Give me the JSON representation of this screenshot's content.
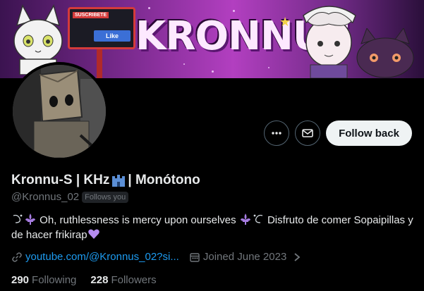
{
  "banner": {
    "title": "KRONNUS",
    "sign_label": "SUSCRIBETE",
    "like_label": "Like"
  },
  "profile": {
    "display_name_part1": "Kronnu-S | KHz",
    "display_name_part2": "| Monótono",
    "handle": "@Kronnus_02",
    "follows_you_badge": "Follows you",
    "bio_part1": "Oh, ruthlessness is mercy upon ourselves",
    "bio_part2": "Disfruto de comer Sopaipillas y de hacer frikirap",
    "link_text": "youtube.com/@Kronnus_02?si...",
    "joined_text": "Joined June 2023",
    "following_count": "290",
    "following_label": "Following",
    "followers_count": "228",
    "followers_label": "Followers"
  },
  "actions": {
    "more_icon": "more-horizontal-icon",
    "message_icon": "envelope-icon",
    "follow_back_label": "Follow back"
  },
  "colors": {
    "background": "#000000",
    "accent_link": "#1d9bf0",
    "muted_text": "#71767b",
    "primary_text": "#e7e9ea",
    "follow_button_bg": "#eff3f4",
    "banner_purple": "#b23fc0",
    "heart": "#b58cf0"
  }
}
